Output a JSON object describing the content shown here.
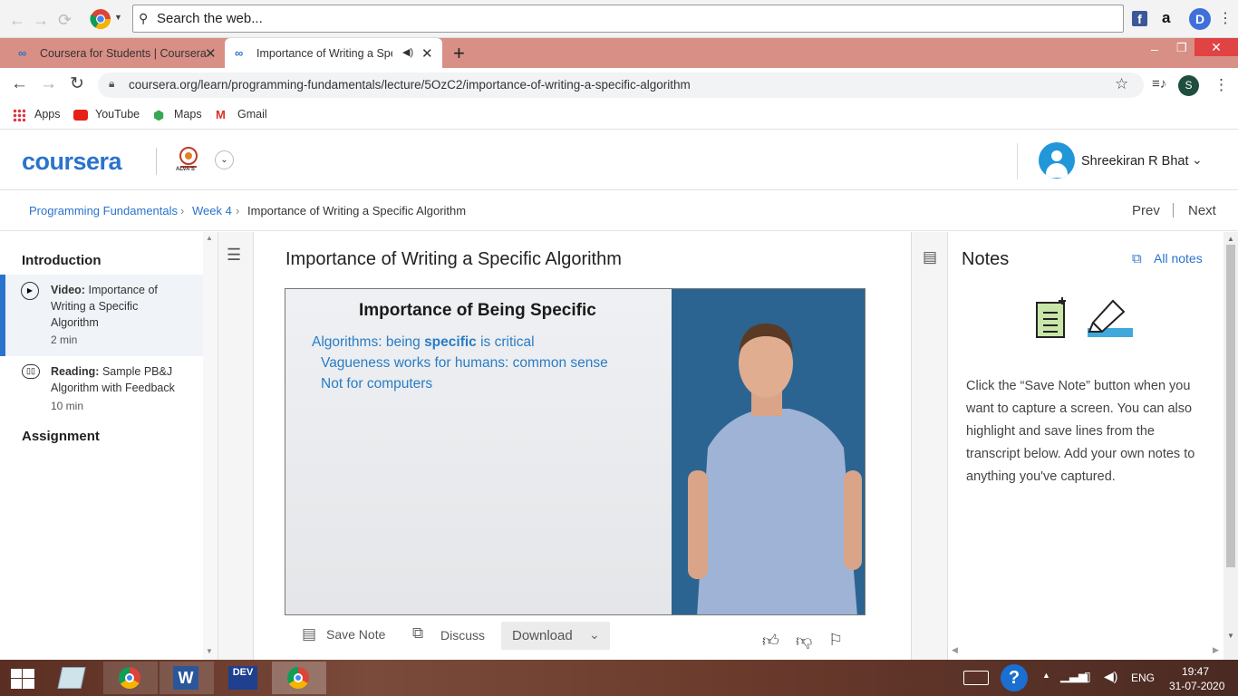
{
  "search_bar": {
    "placeholder": "Search the web..."
  },
  "browser": {
    "tabs": [
      {
        "label": "Coursera for Students | Coursera"
      },
      {
        "label": "Importance of Writing a Spe"
      }
    ],
    "new_tab": "+",
    "url": "coursera.org/learn/programming-fundamentals/lecture/5OzC2/importance-of-writing-a-specific-algorithm",
    "profile_initial": "S",
    "bookmarks": [
      "Apps",
      "YouTube",
      "Maps",
      "Gmail"
    ]
  },
  "header": {
    "logo": "coursera",
    "partner": "ALVA'S",
    "user_name": "Shreekiran R Bhat"
  },
  "breadcrumb": {
    "items": [
      "Programming Fundamentals",
      "Week 4",
      "Importance of Writing a Specific Algorithm"
    ],
    "prev": "Prev",
    "next": "Next"
  },
  "sidebar": {
    "section1": "Introduction",
    "items": [
      {
        "type": "Video:",
        "title": "Importance of Writing a Specific Algorithm",
        "duration": "2 min"
      },
      {
        "type": "Reading:",
        "title": "Sample PB&J Algorithm with Feedback",
        "duration": "10 min"
      }
    ],
    "section2": "Assignment"
  },
  "lecture": {
    "title": "Importance of Writing a Specific Algorithm",
    "slide_title": "Importance of Being Specific",
    "slide_line1_a": "Algorithms: being ",
    "slide_line1_b": "specific",
    "slide_line1_c": " is critical",
    "slide_line2": "Vagueness works for humans: common sense",
    "slide_line3": "Not for computers",
    "save_note": "Save Note",
    "discuss": "Discuss",
    "download": "Download"
  },
  "notes": {
    "title": "Notes",
    "all_notes": "All notes",
    "body": "Click the “Save Note” button when you want to capture a screen. You can also highlight and save lines from the transcript below. Add your own notes to anything you've captured."
  },
  "taskbar": {
    "dev_label": "DEV",
    "lang": "ENG",
    "time": "19:47",
    "date": "31-07-2020"
  },
  "colors": {
    "accent": "#2a73cc",
    "tabstrip": "#d88f86",
    "slide_text": "#2a7cc4",
    "slide_bg": "#e9ebee",
    "video_bg": "#2b6491"
  }
}
